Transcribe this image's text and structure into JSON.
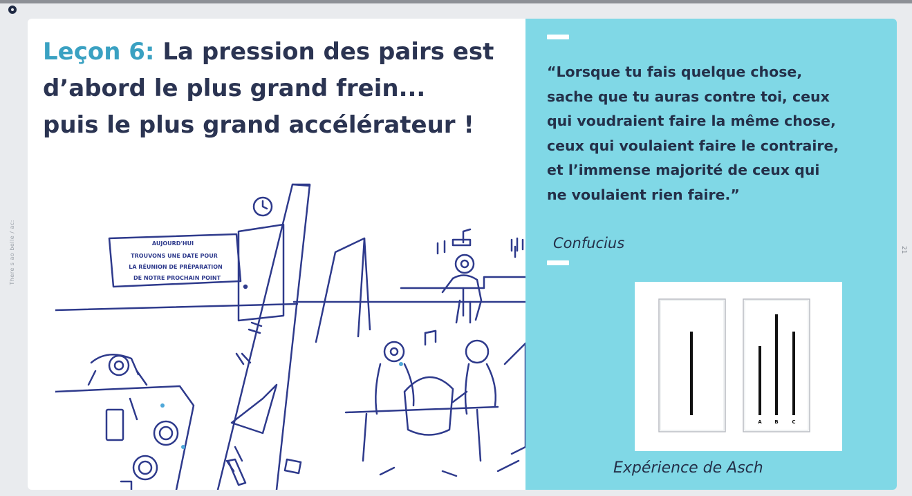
{
  "side_text": "There s ao belle / ac:",
  "page_number": "21",
  "slide": {
    "title": {
      "lesson": "Leçon 6:",
      "line1": "La pression des pairs est",
      "line2": "d’abord le plus grand frein...",
      "line3": "puis le plus grand accélérateur !"
    },
    "illustration": {
      "sign_line1": "AUJOURD'HUI",
      "sign_line2": "TROUVONS UNE DATE POUR",
      "sign_line3": "LA RÉUNION DE PRÉPARATION",
      "sign_line4": "DE NOTRE PROCHAIN POINT"
    },
    "quote": {
      "line1": "“Lorsque tu fais quelque chose,",
      "line2": "sache que tu auras contre toi, ceux",
      "line3": "qui voudraient faire la même chose,",
      "line4": "ceux qui voulaient faire le contraire,",
      "line5": "et l’immense majorité de ceux qui",
      "line6": "ne voulaient rien faire.”"
    },
    "author": "Confucius",
    "asch": {
      "labels": [
        "A",
        "B",
        "C"
      ],
      "caption": "Expérience de Asch"
    }
  },
  "colors": {
    "accent": "#3aa1c2",
    "title": "#2b3452",
    "panel": "#80d8e6",
    "ink": "#2e3a8c"
  }
}
